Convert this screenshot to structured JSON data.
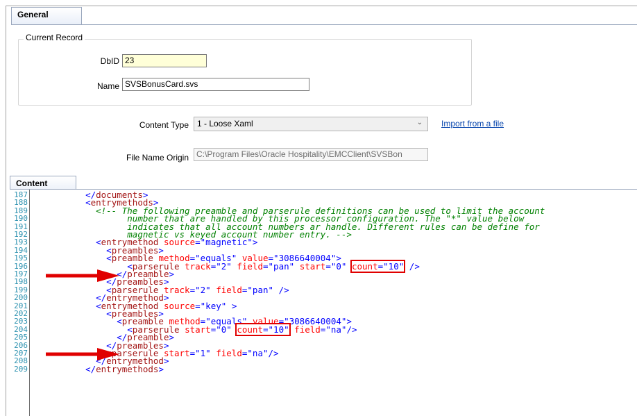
{
  "tabs": {
    "general": "General",
    "content": "Content"
  },
  "current_record": {
    "title": "Current Record",
    "dbid_label": "DbID",
    "dbid_value": "23",
    "name_label": "Name",
    "name_value": "SVSBonusCard.svs"
  },
  "content_type": {
    "label": "Content Type",
    "selected": "1 - Loose Xaml",
    "import_link": "Import from a file"
  },
  "file_name_origin": {
    "label": "File Name Origin",
    "value": "C:\\Program Files\\Oracle Hospitality\\EMCClient\\SVSBon"
  },
  "colors": {
    "accent_red": "#e00000",
    "link": "#0645ad"
  },
  "code_lines": [
    {
      "n": "187",
      "t": "  </documents>"
    },
    {
      "n": "188",
      "t": "  <entrymethods>"
    },
    {
      "n": "189",
      "t": "    <!-- The following preamble and parserule definitions can be used to limit the account"
    },
    {
      "n": "190",
      "t": "          number that are handled by this processor configuration. The \"*\" value below"
    },
    {
      "n": "191",
      "t": "          indicates that all account numbers ar handle. Different rules can be define for"
    },
    {
      "n": "192",
      "t": "          magnetic vs keyed account number entry. -->"
    },
    {
      "n": "193",
      "t": "    <entrymethod source=\"magnetic\">"
    },
    {
      "n": "194",
      "t": "      <preambles>"
    },
    {
      "n": "195",
      "t": "      <preamble method=\"equals\" value=\"3086640004\">"
    },
    {
      "n": "196",
      "t": "          <parserule track=\"2\" field=\"pan\" start=\"0\" count=\"10\" />"
    },
    {
      "n": "197",
      "t": "        </preamble>"
    },
    {
      "n": "198",
      "t": "      </preambles>"
    },
    {
      "n": "199",
      "t": "      <parserule track=\"2\" field=\"pan\" />"
    },
    {
      "n": "200",
      "t": "    </entrymethod>"
    },
    {
      "n": "201",
      "t": "    <entrymethod source=\"key\" >"
    },
    {
      "n": "202",
      "t": "      <preambles>"
    },
    {
      "n": "203",
      "t": "        <preamble method=\"equals\" value=\"3086640004\">"
    },
    {
      "n": "204",
      "t": "          <parserule start=\"0\" count=\"10\" field=\"na\"/>"
    },
    {
      "n": "205",
      "t": "        </preamble>"
    },
    {
      "n": "206",
      "t": "      </preambles>"
    },
    {
      "n": "207",
      "t": "      <parserule start=\"1\" field=\"na\"/>"
    },
    {
      "n": "208",
      "t": "    </entrymethod>"
    },
    {
      "n": "209",
      "t": "  </entrymethods>"
    }
  ]
}
